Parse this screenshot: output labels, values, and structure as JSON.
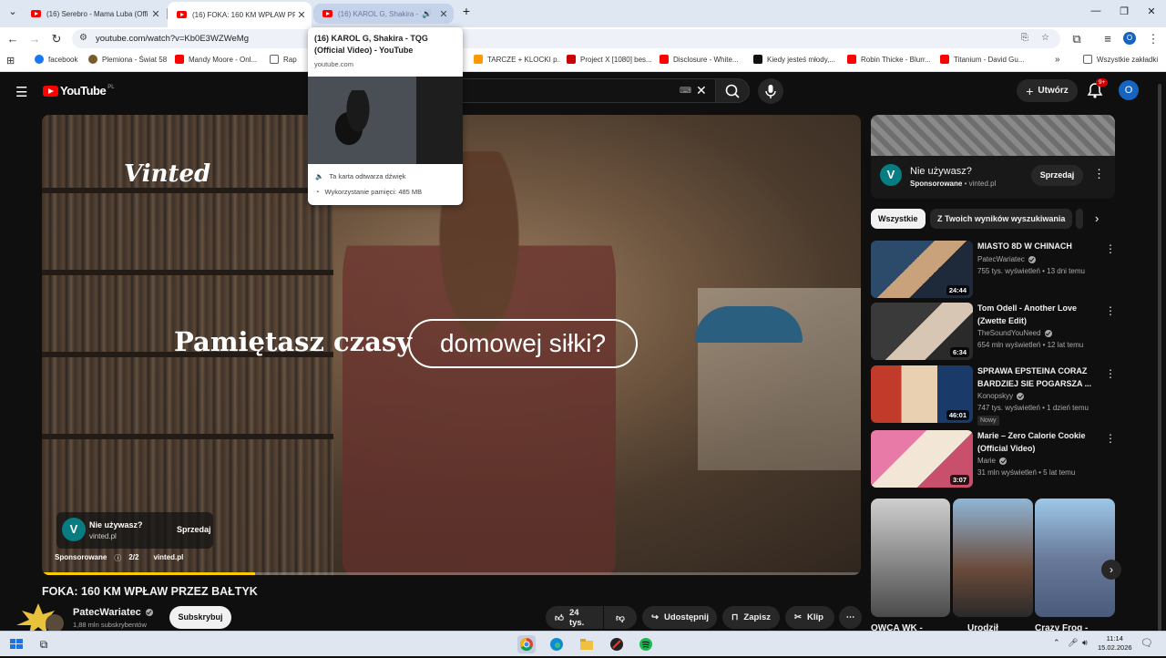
{
  "browser": {
    "tabs": [
      {
        "title": "(16) Serebro - Mama Luba (Offi"
      },
      {
        "title": "(16) FOKA: 160 KM WPŁAW PRZ"
      },
      {
        "title": "(16) KAROL G, Shakira - TQG"
      }
    ],
    "new_tab": "+",
    "url": "youtube.com/watch?v=Kb0E3WZWeMg",
    "bookmarks": [
      {
        "label": "facebook",
        "color": "#1877f2"
      },
      {
        "label": "Plemiona - Świat 58",
        "color": "#7a5a2a"
      },
      {
        "label": "Mandy Moore - Onl...",
        "color": "#ff0000"
      },
      {
        "label": "Rap",
        "color": "#5f6368"
      },
      {
        "label": "TARCZE + KLOCKI p...",
        "color": "#ff9900"
      },
      {
        "label": "Project X [1080] bes...",
        "color": "#cc0000"
      },
      {
        "label": "Disclosure - White...",
        "color": "#ff0000"
      },
      {
        "label": "Kiedy jesteś młody,...",
        "color": "#111111"
      },
      {
        "label": "Robin Thicke - Blurr...",
        "color": "#ff0000"
      },
      {
        "label": "Titanium - David Gu...",
        "color": "#ff0000"
      }
    ],
    "all_bookmarks": "Wszystkie zakładki",
    "hovercard": {
      "title": "(16) KAROL G, Shakira - TQG (Official Video) - YouTube",
      "url": "youtube.com",
      "audio": "Ta karta odtwarza dźwięk",
      "memory": "Wykorzystanie pamięci: 485 MB"
    }
  },
  "youtube": {
    "logo": "YouTube",
    "country": "PL",
    "create_label": "Utwórz",
    "notif_count": "9+",
    "avatar_letter": "O",
    "player": {
      "brand": "Vinted",
      "headline": "Pamiętasz czasy",
      "headline_pill": "domowej siłki?",
      "ad_card_title": "Nie używasz?",
      "ad_card_domain": "vinted.pl",
      "ad_card_button": "Sprzedaj",
      "ad_meta_sponsored": "Sponsorowane",
      "ad_meta_count": "2/2",
      "ad_meta_domain": "vinted.pl",
      "progress_pct": 26
    },
    "video": {
      "title": "FOKA: 160 KM WPŁAW PRZEZ BAŁTYK",
      "channel": "PatecWariatec",
      "subscribers": "1,88 mln subskrybentów",
      "subscribe_label": "Subskrybuj",
      "likes": "24 tys.",
      "share_label": "Udostępnij",
      "save_label": "Zapisz",
      "clip_label": "Klip"
    },
    "side_ad": {
      "title": "Nie używasz?",
      "sponsored": "Sponsorowane",
      "domain": "vinted.pl",
      "button": "Sprzedaj"
    },
    "chips": [
      "Wszystkie",
      "Z Twoich wyników wyszukiwania"
    ],
    "recommendations": [
      {
        "title": "MIASTO 8D W CHINACH",
        "channel": "PatecWariatec",
        "meta": "755 tys. wyświetleń • 13 dni temu",
        "duration": "24:44",
        "badge": ""
      },
      {
        "title": "Tom Odell - Another Love (Zwette Edit)",
        "channel": "TheSoundYouNeed",
        "meta": "654 mln wyświetleń • 12 lat temu",
        "duration": "6:34",
        "badge": ""
      },
      {
        "title": "SPRAWA EPSTEINA CORAZ BARDZIEJ SIE POGARSZA ...",
        "channel": "Konopskyy",
        "meta": "747 tys. wyświetleń • 1 dzień temu",
        "duration": "46:01",
        "badge": "Nowy"
      },
      {
        "title": "Marie – Zero Calorie Cookie (Official Video)",
        "channel": "Marie",
        "meta": "31 mln wyświetleń • 5 lat temu",
        "duration": "3:07",
        "badge": ""
      }
    ],
    "shorts_labels": [
      "OWCA WK -",
      "Urodził",
      "Crazy Frog -"
    ]
  },
  "taskbar": {
    "time": "11:14",
    "date": "15.02.2026"
  },
  "colors": {
    "yt_red": "#ff0000",
    "progress": "#ffcc00",
    "vinted": "#077d82"
  }
}
